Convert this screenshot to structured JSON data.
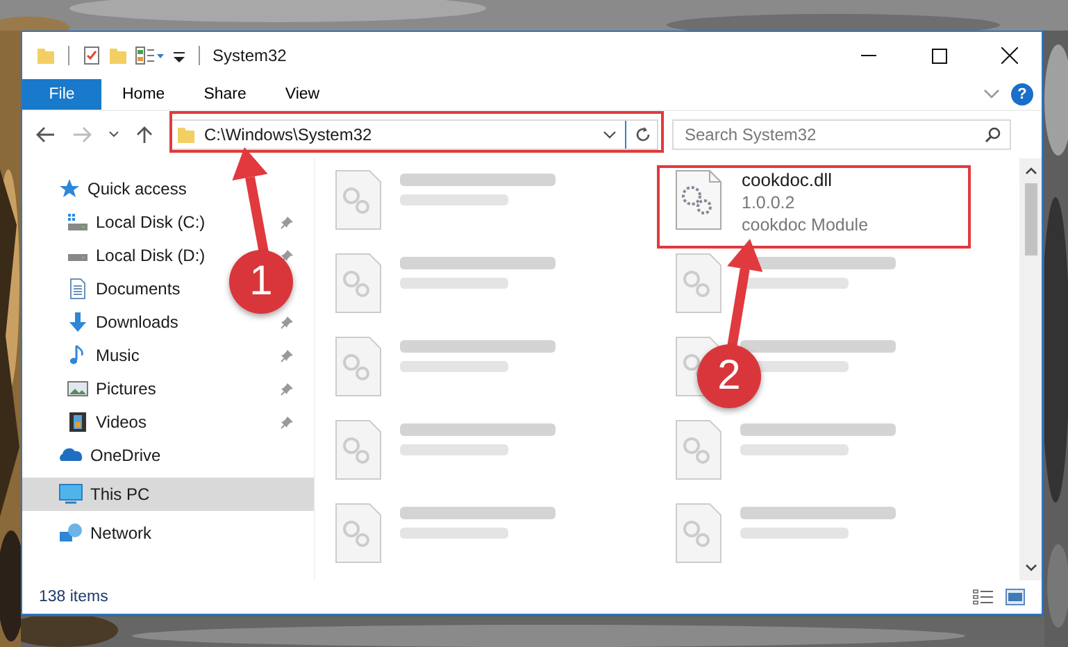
{
  "window": {
    "title": "System32"
  },
  "ribbon": {
    "tabs": [
      {
        "label": "File",
        "kind": "file",
        "selected": false
      },
      {
        "label": "Home",
        "kind": "tab",
        "selected": false
      },
      {
        "label": "Share",
        "kind": "tab",
        "selected": false
      },
      {
        "label": "View",
        "kind": "tab",
        "selected": false
      }
    ],
    "help": "?"
  },
  "address": {
    "path": "C:\\Windows\\System32"
  },
  "search": {
    "placeholder": "Search System32"
  },
  "navigation": [
    {
      "label": "Quick access",
      "kind": "quick",
      "selected": false,
      "children": [
        {
          "label": "Local Disk (C:)",
          "kind": "drive-c",
          "pinned": true
        },
        {
          "label": "Local Disk (D:)",
          "kind": "drive",
          "pinned": true
        },
        {
          "label": "Documents",
          "kind": "documents",
          "pinned": false
        },
        {
          "label": "Downloads",
          "kind": "downloads",
          "pinned": true
        },
        {
          "label": "Music",
          "kind": "music",
          "pinned": true
        },
        {
          "label": "Pictures",
          "kind": "pictures",
          "pinned": true
        },
        {
          "label": "Videos",
          "kind": "videos",
          "pinned": true
        }
      ]
    },
    {
      "label": "OneDrive",
      "kind": "onedrive",
      "selected": false
    },
    {
      "label": "This PC",
      "kind": "pc",
      "selected": true
    },
    {
      "label": "Network",
      "kind": "network",
      "selected": false
    }
  ],
  "files": [
    {
      "blurred": true
    },
    {
      "name": "cookdoc.dll",
      "details": [
        "1.0.0.2",
        "cookdoc Module"
      ],
      "blurred": false
    },
    {
      "blurred": true
    },
    {
      "blurred": true
    },
    {
      "blurred": true
    },
    {
      "blurred": true
    },
    {
      "blurred": true
    },
    {
      "blurred": true
    },
    {
      "blurred": true
    },
    {
      "blurred": true
    }
  ],
  "status_bar": {
    "count": "138 items"
  },
  "annotations": [
    {
      "number": "1"
    },
    {
      "number": "2"
    }
  ]
}
